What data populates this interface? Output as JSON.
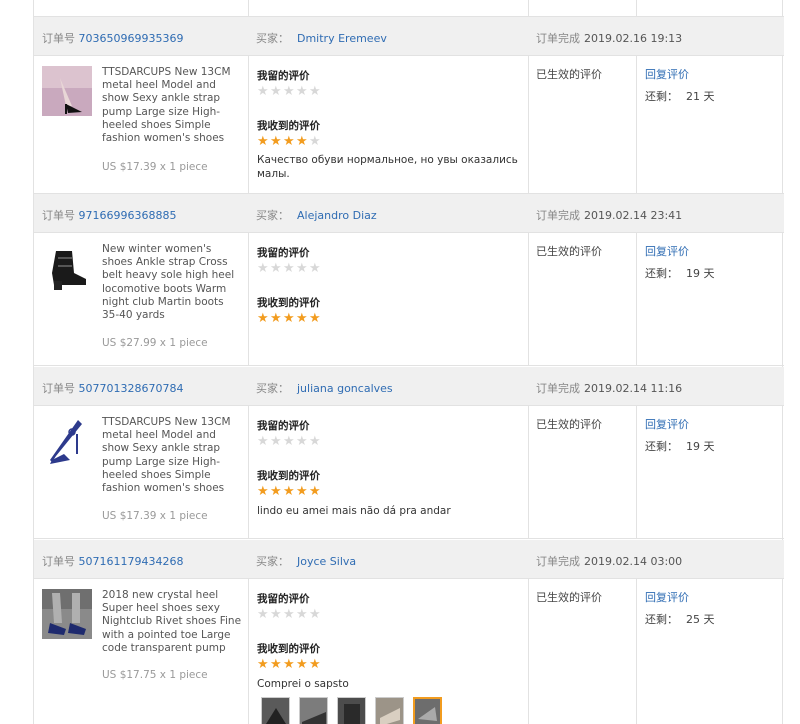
{
  "labels": {
    "order_no": "订单号",
    "buyer": "买家：",
    "completed": "订单完成",
    "my_review": "我留的评价",
    "received_review": "我收到的评价",
    "reply": "回复评价",
    "remaining": "还剩：",
    "status": "已生效的评价"
  },
  "colors": {
    "star_on": "#f29c1f",
    "star_off": "#d8d8d8",
    "link": "#2f6cb3",
    "header_bg": "#f0f0f0"
  },
  "orders": [
    {
      "order_no": "703650969935369",
      "buyer": "Dmitry Eremeev",
      "completed": "2019.02.16 19:13",
      "product_title": "TTSDARCUPS New 13CM metal heel Model and show Sexy ankle strap pump Large size High-heeled shoes Simple fashion women's shoes",
      "price": "US $17.39 x 1 piece",
      "my_stars": 0,
      "received_stars": 4,
      "feedback": "Качество обуви нормальное, но увы оказались малы.",
      "days_left": "21 天"
    },
    {
      "order_no": "97166996368885",
      "buyer": "Alejandro Diaz",
      "completed": "2019.02.14 23:41",
      "product_title": "New winter women's shoes Ankle strap Cross belt heavy sole high heel locomotive boots Warm night club Martin boots 35-40 yards",
      "price": "US $27.99 x 1 piece",
      "my_stars": 0,
      "received_stars": 5,
      "feedback": "",
      "days_left": "19 天"
    },
    {
      "order_no": "507701328670784",
      "buyer": "juliana goncalves",
      "completed": "2019.02.14 11:16",
      "product_title": "TTSDARCUPS New 13CM metal heel Model and show Sexy ankle strap pump Large size High-heeled shoes Simple fashion women's shoes",
      "price": "US $17.39 x 1 piece",
      "my_stars": 0,
      "received_stars": 5,
      "feedback": "lindo eu amei mais não dá pra andar",
      "days_left": "19 天"
    },
    {
      "order_no": "507161179434268",
      "buyer": "Joyce Silva",
      "completed": "2019.02.14 03:00",
      "product_title": "2018 new crystal heel Super heel shoes sexy Nightclub Rivet shoes Fine with a pointed toe Large code transparent pump",
      "price": "US $17.75 x 1 piece",
      "my_stars": 0,
      "received_stars": 5,
      "feedback": "Comprei o sapsto",
      "days_left": "25 天",
      "photo_count": 5,
      "selected_photo": 5
    }
  ]
}
